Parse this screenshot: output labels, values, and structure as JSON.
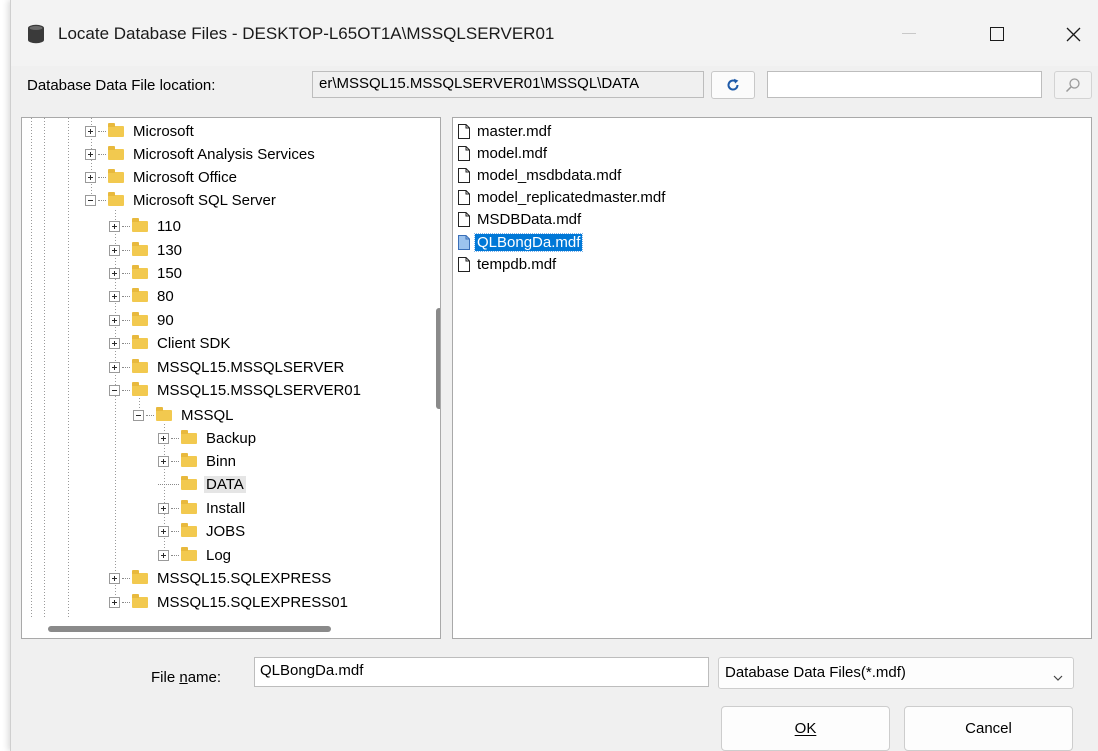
{
  "title": "Locate Database Files - DESKTOP-L65OT1A\\MSSQLSERVER01",
  "location": {
    "label": "Database Data File location:",
    "value": "er\\MSSQL15.MSSQLSERVER01\\MSSQL\\DATA",
    "search_value": ""
  },
  "tree": {
    "items": [
      {
        "label": "Microsoft",
        "expanded": false
      },
      {
        "label": "Microsoft Analysis Services",
        "expanded": false
      },
      {
        "label": "Microsoft Office",
        "expanded": false
      },
      {
        "label": "Microsoft SQL Server",
        "expanded": true
      },
      {
        "label": "110",
        "expanded": false
      },
      {
        "label": "130",
        "expanded": false
      },
      {
        "label": "150",
        "expanded": false
      },
      {
        "label": "80",
        "expanded": false
      },
      {
        "label": "90",
        "expanded": false
      },
      {
        "label": "Client SDK",
        "expanded": false
      },
      {
        "label": "MSSQL15.MSSQLSERVER",
        "expanded": false
      },
      {
        "label": "MSSQL15.MSSQLSERVER01",
        "expanded": true
      },
      {
        "label": "MSSQL",
        "expanded": true
      },
      {
        "label": "Backup",
        "expanded": false
      },
      {
        "label": "Binn",
        "expanded": false
      },
      {
        "label": "DATA",
        "expanded": null,
        "selected": true
      },
      {
        "label": "Install",
        "expanded": false
      },
      {
        "label": "JOBS",
        "expanded": false
      },
      {
        "label": "Log",
        "expanded": false
      },
      {
        "label": "MSSQL15.SQLEXPRESS",
        "expanded": false
      },
      {
        "label": "MSSQL15.SQLEXPRESS01",
        "expanded": false
      }
    ]
  },
  "files": {
    "items": [
      {
        "name": "master.mdf",
        "selected": false
      },
      {
        "name": "model.mdf",
        "selected": false
      },
      {
        "name": "model_msdbdata.mdf",
        "selected": false
      },
      {
        "name": "model_replicatedmaster.mdf",
        "selected": false
      },
      {
        "name": "MSDBData.mdf",
        "selected": false
      },
      {
        "name": "QLBongDa.mdf",
        "selected": true
      },
      {
        "name": "tempdb.mdf",
        "selected": false
      }
    ]
  },
  "filename": {
    "label_pre": "File ",
    "label_accel": "n",
    "label_post": "ame:",
    "value": "QLBongDa.mdf"
  },
  "filter": {
    "selected": "Database Data Files(*.mdf)"
  },
  "buttons": {
    "ok": "OK",
    "cancel": "Cancel"
  },
  "colors": {
    "selection": "#0078d7",
    "folder": "#f2c94f"
  },
  "icons": [
    "database-icon",
    "minimize-icon",
    "maximize-icon",
    "close-icon",
    "refresh-icon",
    "search-icon",
    "folder-icon",
    "file-icon",
    "chevron-down-icon"
  ]
}
